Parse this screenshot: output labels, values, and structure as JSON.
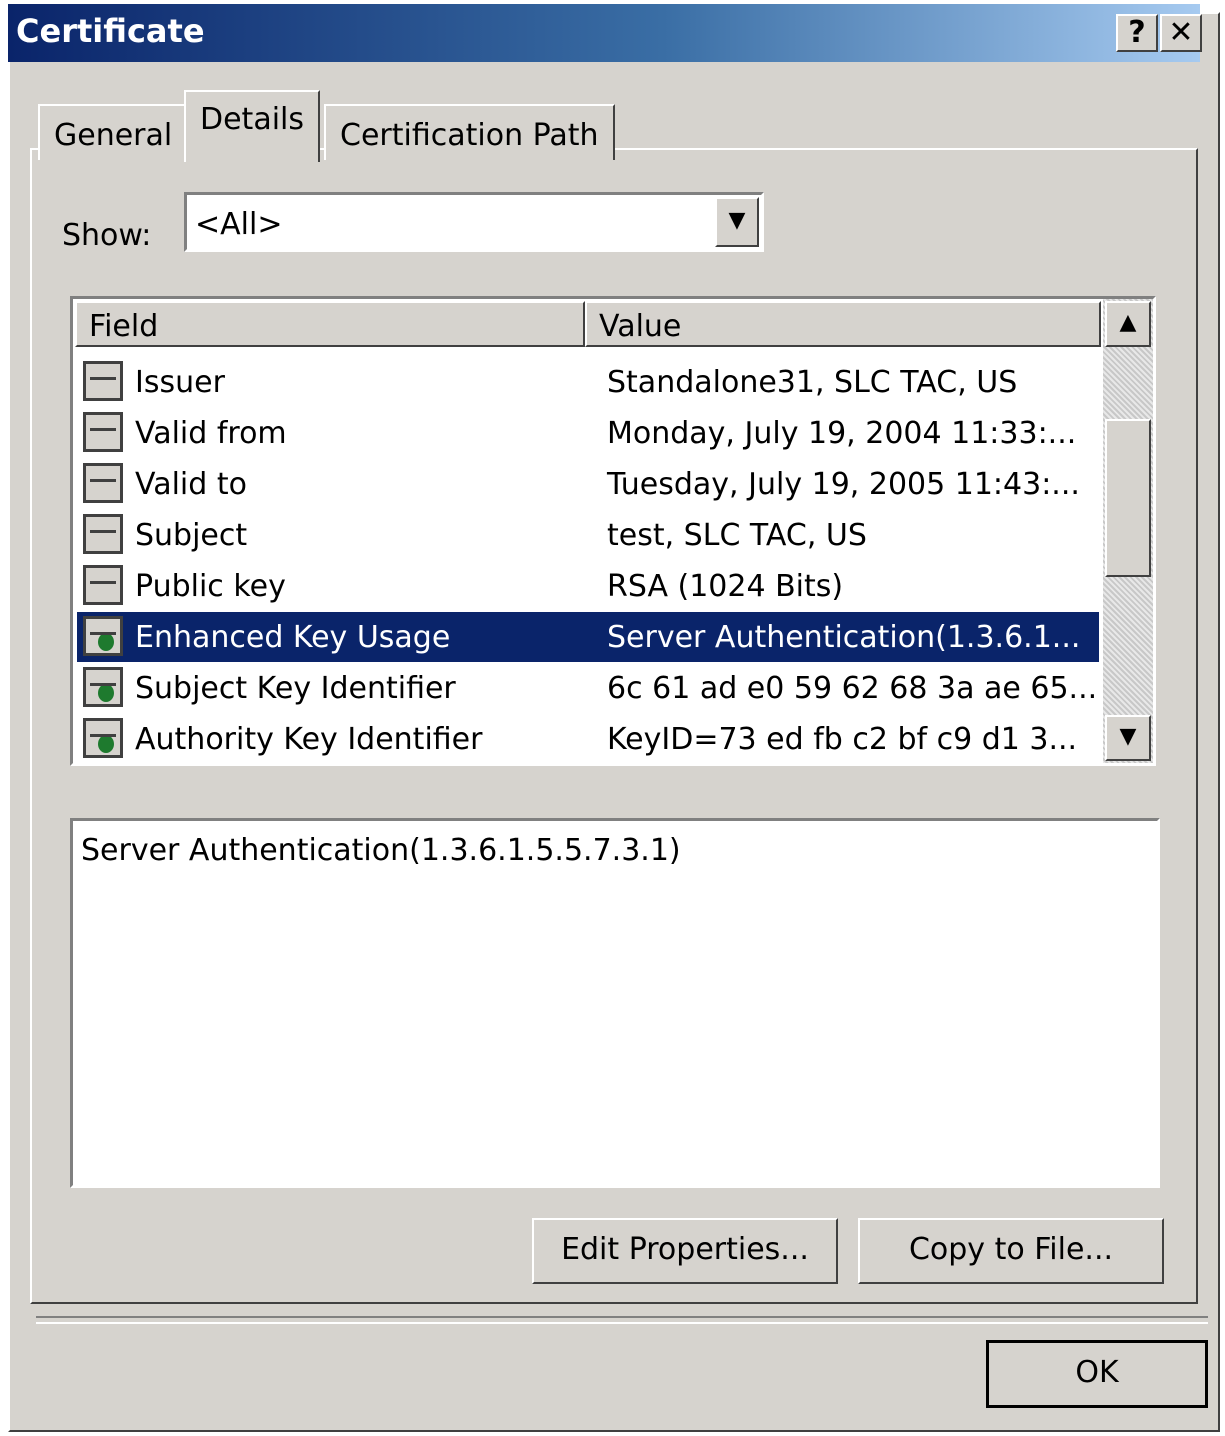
{
  "window": {
    "title": "Certificate",
    "help_label": "?",
    "close_label": "✕"
  },
  "tabs": [
    {
      "label": "General"
    },
    {
      "label": "Details"
    },
    {
      "label": "Certification Path"
    }
  ],
  "show": {
    "label": "Show:",
    "value": "<All>"
  },
  "list": {
    "columns": {
      "field": "Field",
      "value": "Value"
    },
    "rows": [
      {
        "field": "Issuer",
        "value": "Standalone31, SLC TAC, US",
        "icon": "certificate-field-icon"
      },
      {
        "field": "Valid from",
        "value": "Monday, July 19, 2004 11:33:...",
        "icon": "certificate-field-icon"
      },
      {
        "field": "Valid to",
        "value": "Tuesday, July 19, 2005 11:43:...",
        "icon": "certificate-field-icon"
      },
      {
        "field": "Subject",
        "value": "test, SLC TAC, US",
        "icon": "certificate-field-icon"
      },
      {
        "field": "Public key",
        "value": "RSA (1024 Bits)",
        "icon": "certificate-field-icon"
      },
      {
        "field": "Enhanced Key Usage",
        "value": "Server Authentication(1.3.6.1...",
        "icon": "certificate-extension-icon",
        "selected": true
      },
      {
        "field": "Subject Key Identifier",
        "value": "6c 61 ad e0 59 62 68 3a ae 65...",
        "icon": "certificate-extension-icon"
      },
      {
        "field": "Authority Key Identifier",
        "value": "KeyID=73 ed fb c2 bf c9 d1 3...",
        "icon": "certificate-extension-icon"
      }
    ]
  },
  "detail": {
    "text": "Server Authentication(1.3.6.1.5.5.7.3.1)"
  },
  "buttons": {
    "edit_properties": "Edit Properties...",
    "copy_to_file": "Copy to File...",
    "ok": "OK"
  },
  "colors": {
    "title_bar": "#0a246a",
    "selection": "#0a246a",
    "face": "#d6d3ce"
  }
}
